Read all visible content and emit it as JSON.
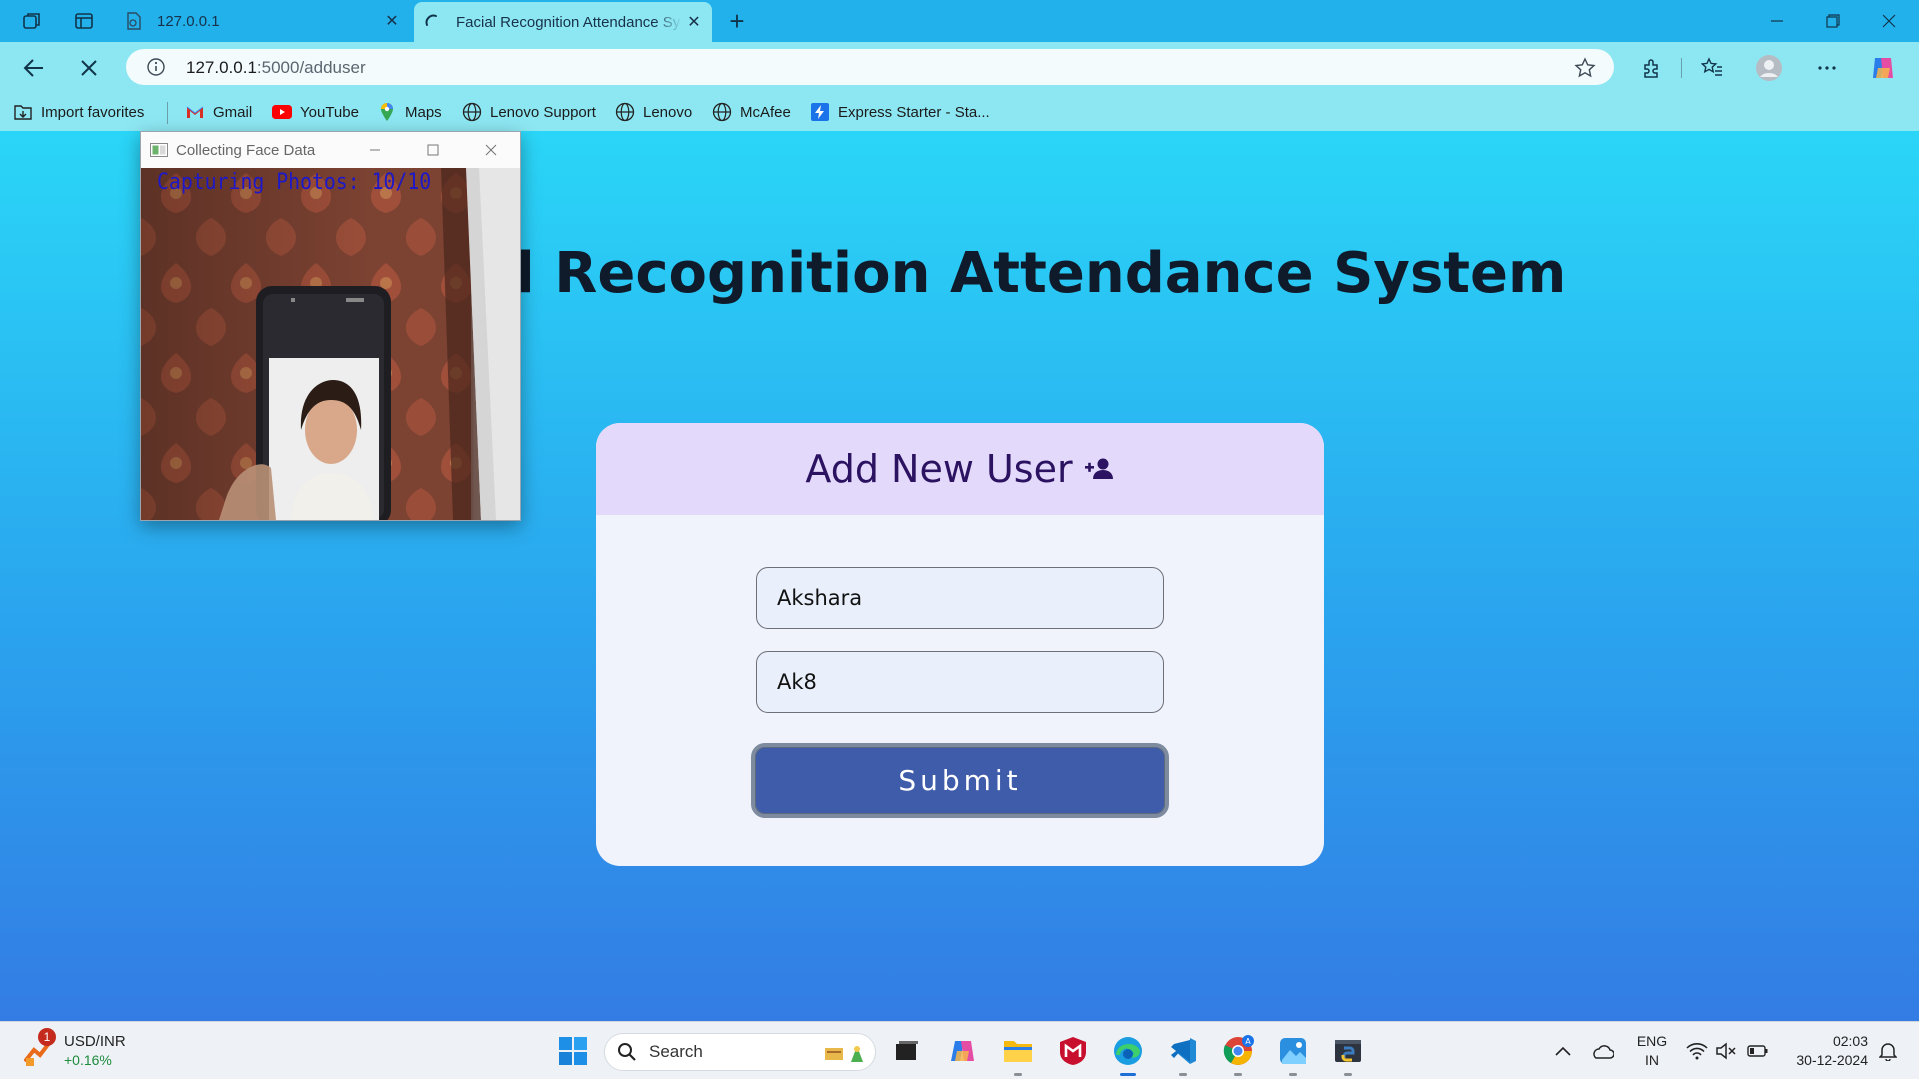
{
  "browser": {
    "tabs": [
      {
        "title": "127.0.0.1",
        "active": false
      },
      {
        "title": "Facial Recognition Attendance System",
        "active": true
      }
    ],
    "url_host": "127.0.0.1",
    "url_path": ":5000/adduser",
    "bookmarks": [
      {
        "label": "Import favorites",
        "icon": "import-icon"
      },
      {
        "label": "Gmail",
        "icon": "gmail-icon"
      },
      {
        "label": "YouTube",
        "icon": "youtube-icon"
      },
      {
        "label": "Maps",
        "icon": "maps-icon"
      },
      {
        "label": "Lenovo Support",
        "icon": "globe-icon"
      },
      {
        "label": "Lenovo",
        "icon": "globe-icon"
      },
      {
        "label": "McAfee",
        "icon": "globe-icon"
      },
      {
        "label": "Express Starter - Sta...",
        "icon": "express-icon"
      }
    ]
  },
  "page": {
    "title": "Facial Recognition Attendance System",
    "card_title": "Add New User",
    "name_value": "Akshara",
    "id_value": "Ak8",
    "submit_label": "Submit"
  },
  "capture_window": {
    "title": "Collecting Face Data",
    "caption": "Capturing Photos: 10/10"
  },
  "taskbar": {
    "widget_label": "USD/INR",
    "widget_change": "+0.16%",
    "widget_badge": "1",
    "search_label": "Search",
    "lang_top": "ENG",
    "lang_bottom": "IN",
    "time": "02:03",
    "date": "30-12-2024"
  },
  "colors": {
    "tab_bar": "#23b1ec",
    "toolbar": "#8de7f2",
    "page_gradient_top": "#2ad6f7",
    "page_gradient_bottom": "#337ce4",
    "card_header": "#e3d9fa",
    "submit_button": "#3f5caa"
  }
}
